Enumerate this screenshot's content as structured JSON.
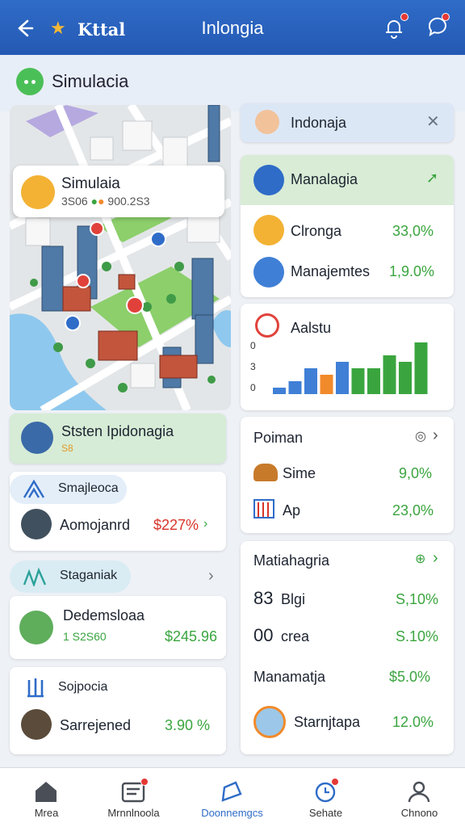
{
  "header": {
    "brand": "Kttal",
    "title": "Inlongia"
  },
  "subheader": {
    "label": "Simulacia"
  },
  "map_popup": {
    "name": "Simulaia",
    "sub_left": "3S06",
    "sub_right": "900.2S3"
  },
  "status_card": {
    "title": "Ststen Ipidonagia",
    "badge": "S8"
  },
  "left_cards": [
    {
      "header": "Smajleoca",
      "name": "Aomojanrd",
      "value": "$227%"
    },
    {
      "header": "Staganiak",
      "name": "Dedemsloaa",
      "sub": "1 S2S60",
      "value": "$245.96"
    },
    {
      "header": "Sojpocia",
      "name": "Sarrejened",
      "value": "3.90 %"
    }
  ],
  "right": {
    "notice": {
      "label": "Indonaja"
    },
    "manalagia": {
      "title": "Manalagia",
      "rows": [
        {
          "name": "Clronga",
          "value": "33,0%"
        },
        {
          "name": "Manajemtes",
          "value": "1,9.0%"
        }
      ]
    },
    "chart_card": {
      "title": "Aalstu"
    },
    "poiman": {
      "title": "Poiman",
      "rows": [
        {
          "name": "Sime",
          "value": "9,0%"
        },
        {
          "name": "Ap",
          "value": "23,0%"
        }
      ]
    },
    "matiahagria": {
      "title": "Matiahagria",
      "rows": [
        {
          "name": "Blgi",
          "lead": "83",
          "value": "S,10%"
        },
        {
          "name": "crea",
          "lead": "00",
          "value": "S.10%"
        },
        {
          "name": "Manamatja",
          "lead": "",
          "value": "$5.0%"
        },
        {
          "name": "Starnjtapa",
          "lead": "",
          "value": "12.0%"
        }
      ]
    }
  },
  "chart_data": {
    "type": "bar",
    "y_tick_labels": [
      "0",
      "3",
      "0"
    ],
    "values": [
      1,
      2,
      4,
      3,
      5,
      4,
      4,
      6,
      5,
      8
    ],
    "colors": [
      "#3f7fd6",
      "#3f7fd6",
      "#3f7fd6",
      "#f18a2a",
      "#3f7fd6",
      "#3aa53f",
      "#3aa53f",
      "#3aa53f",
      "#3aa53f",
      "#3aa53f"
    ]
  },
  "bottom_nav": [
    {
      "label": "Mrea",
      "icon": "home-icon"
    },
    {
      "label": "Mrnnlnoola",
      "icon": "inbox-icon"
    },
    {
      "label": "Doonnemgcs",
      "icon": "map-icon"
    },
    {
      "label": "Sehate",
      "icon": "clock-icon"
    },
    {
      "label": "Chnono",
      "icon": "user-icon"
    }
  ]
}
